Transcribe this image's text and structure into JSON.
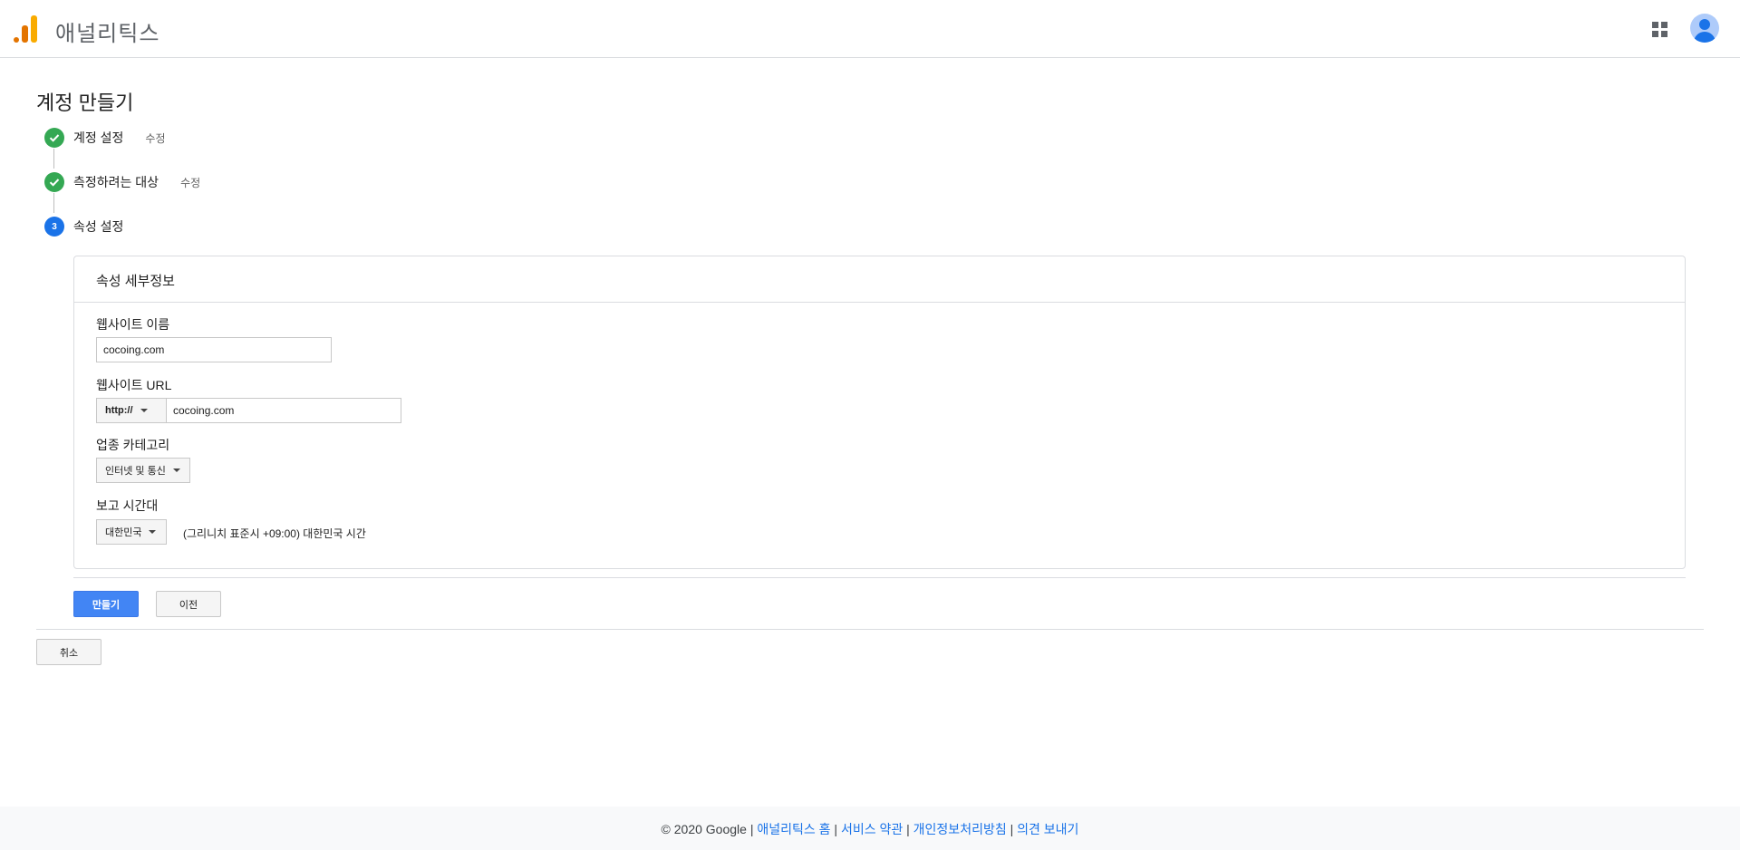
{
  "header": {
    "app_title": "애널리틱스"
  },
  "page": {
    "title": "계정 만들기"
  },
  "steps": [
    {
      "number": "1",
      "label": "계정 설정",
      "edit_label": "수정",
      "status": "done"
    },
    {
      "number": "2",
      "label": "측정하려는 대상",
      "edit_label": "수정",
      "status": "done"
    },
    {
      "number": "3",
      "label": "속성 설정",
      "status": "current"
    }
  ],
  "card": {
    "title": "속성 세부정보",
    "website_name": {
      "label": "웹사이트 이름",
      "value": "cocoing.com"
    },
    "website_url": {
      "label": "웹사이트 URL",
      "protocol": "http://",
      "value": "cocoing.com"
    },
    "industry": {
      "label": "업종 카테고리",
      "selected": "인터넷 및 통신"
    },
    "timezone": {
      "label": "보고 시간대",
      "country": "대한민국",
      "zone_text": "(그리니치 표준시 +09:00) 대한민국 시간"
    }
  },
  "buttons": {
    "create": "만들기",
    "previous": "이전",
    "cancel": "취소"
  },
  "footer": {
    "copyright": "© 2020 Google",
    "separator": "|",
    "links": [
      "애널리틱스 홈",
      "서비스 약관",
      "개인정보처리방침",
      "의견 보내기"
    ]
  },
  "colors": {
    "accent": "#4285f4",
    "step_done": "#34a853",
    "step_current": "#1a73e8",
    "logo_orange": "#e37400",
    "logo_yellow": "#f9ab00"
  },
  "icons": {
    "apps": "apps-grid-icon",
    "account": "account-avatar-icon",
    "check": "check-icon"
  }
}
